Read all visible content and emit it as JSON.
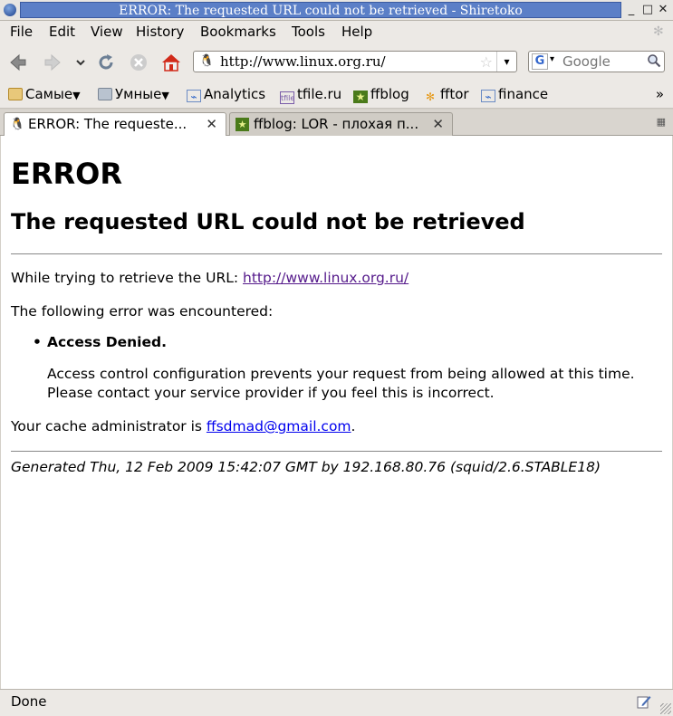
{
  "window": {
    "title": "ERROR: The requested URL could not be retrieved - Shiretoko",
    "minimize_glyph": "_",
    "maximize_glyph": "□",
    "close_glyph": "✕"
  },
  "menu": {
    "items": [
      "File",
      "Edit",
      "View",
      "History",
      "Bookmarks",
      "Tools",
      "Help"
    ]
  },
  "nav": {
    "back_icon": "back-icon",
    "forward_icon": "forward-icon",
    "url": "http://www.linux.org.ru/",
    "search_placeholder": "Google",
    "search_engine_letter": "G"
  },
  "bookmarks": {
    "items": [
      {
        "label": "Самые",
        "icon": "folder-icon",
        "dropdown": true
      },
      {
        "label": "Умные",
        "icon": "folder-icon",
        "dropdown": true
      },
      {
        "label": "Analytics",
        "icon": "chart-icon"
      },
      {
        "label": "tfile.ru",
        "icon": "tfile-icon"
      },
      {
        "label": "ffblog",
        "icon": "ffblog-icon"
      },
      {
        "label": "fftor",
        "icon": "fftor-icon"
      },
      {
        "label": "finance",
        "icon": "chart-icon"
      }
    ],
    "overflow": "»"
  },
  "tabs": [
    {
      "label": "ERROR: The requeste...",
      "active": true
    },
    {
      "label": "ffblog: LOR - плохая п...",
      "active": false
    }
  ],
  "page": {
    "h1": "ERROR",
    "h2": "The requested URL could not be retrieved",
    "retrieve_prefix": "While trying to retrieve the URL: ",
    "retrieve_url": "http://www.linux.org.ru/",
    "error_intro": "The following error was encountered:",
    "error_item": "Access Denied.",
    "error_detail": "Access control configuration prevents your request from being allowed at this time. Please contact your service provider if you feel this is incorrect.",
    "admin_prefix": "Your cache administrator is ",
    "admin_email": "ffsdmad@gmail.com",
    "admin_suffix": ".",
    "footer": "Generated Thu, 12 Feb 2009 15:42:07 GMT by 192.168.80.76 (squid/2.6.STABLE18)"
  },
  "status": {
    "text": "Done"
  },
  "colors": {
    "titlebar_active": "#5b7fc7",
    "visited_link": "#551a8b",
    "link": "#0000ee"
  }
}
